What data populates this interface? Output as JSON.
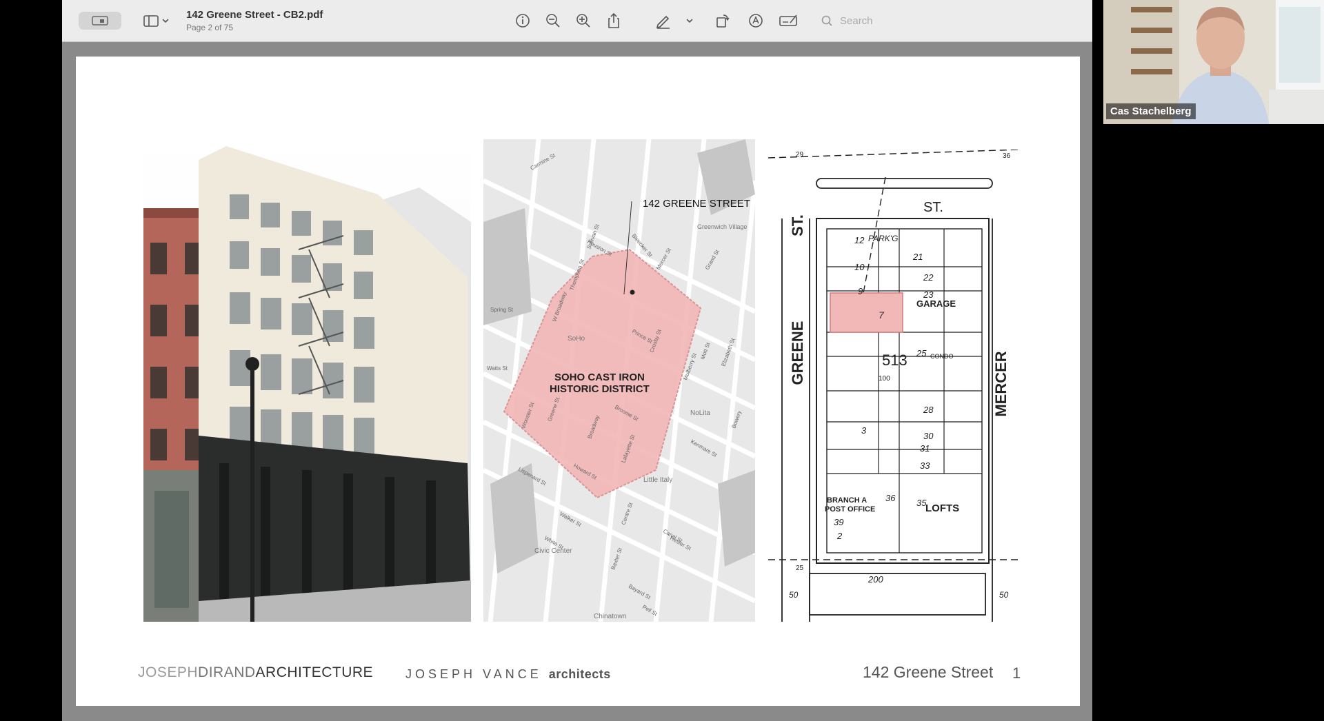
{
  "toolbar": {
    "title": "142 Greene Street - CB2.pdf",
    "page_indicator": "Page 2 of 75",
    "search_placeholder": "Search"
  },
  "slide": {
    "map": {
      "address_label": "142 GREENE STREET",
      "district_label_line1": "SOHO CAST IRON",
      "district_label_line2": "HISTORIC DISTRICT",
      "neighborhoods": [
        "SoHo",
        "Greenwich Village",
        "NoLita",
        "Little Italy",
        "Civic Center",
        "Chinatown"
      ],
      "streets": [
        "Spring St",
        "Prince St",
        "Broadway",
        "Canal St",
        "Houston St",
        "Bleecker St",
        "Mercer St",
        "Grand St",
        "Howard St",
        "Lafayette St",
        "Broome St",
        "Crosby St",
        "Elizabeth St",
        "Mott St",
        "Mulberry St",
        "Bowery",
        "Lispenard St",
        "Walker St",
        "White St",
        "Kenmare St",
        "Centre St",
        "Baxter St",
        "Hester St",
        "Bayard St",
        "Pell St",
        "Wooster St",
        "Greene St",
        "W Broadway",
        "Thompson St",
        "Sullivan St",
        "Watts St",
        "Carmine St"
      ]
    },
    "plan": {
      "top_street": "ST.",
      "left_street": "GREENE",
      "left_street_st": "ST.",
      "right_street": "MERCER",
      "block_number": "513",
      "garage": "GARAGE",
      "condo": "CONDO",
      "parking": "PARK'G",
      "post_office_1": "BRANCH A",
      "post_office_2": "POST OFFICE",
      "lofts": "LOFTS",
      "highlight_lot": "7",
      "lot_numbers": [
        "12",
        "10",
        "9",
        "21",
        "22",
        "23",
        "25",
        "28",
        "30",
        "31",
        "33",
        "35",
        "36",
        "39",
        "3",
        "2"
      ],
      "dims": [
        "200",
        "50",
        "25",
        "29",
        "36",
        "100"
      ]
    },
    "footer": {
      "firm_a_light": "JOSEPH",
      "firm_a_mid": "DIRAND",
      "firm_a_dark": "ARCHITECTURE",
      "firm_b_name": "JOSEPH VANCE",
      "firm_b_suffix": "architects",
      "address": "142 Greene Street",
      "page_number": "1"
    }
  },
  "video": {
    "participant_name": "Cas Stachelberg"
  },
  "colors": {
    "highlight": "#f2b8b8",
    "toolbar_bg": "#ececec",
    "viewer_bg": "#8a8a8a"
  }
}
